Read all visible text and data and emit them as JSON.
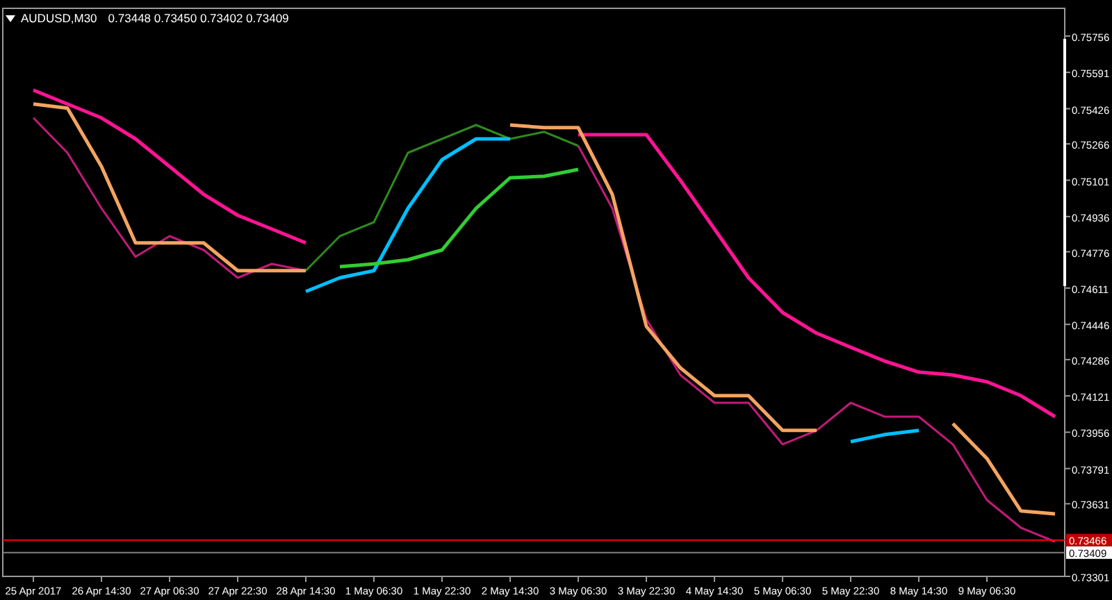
{
  "header": {
    "symbol": "AUDUSD,M30",
    "prices": [
      "0.73448",
      "0.73450",
      "0.73402",
      "0.73409"
    ]
  },
  "chart_data": {
    "type": "line",
    "categories": [
      "25 Apr 2017",
      null,
      "26 Apr 14:30",
      null,
      "27 Apr 06:30",
      null,
      "27 Apr 22:30",
      null,
      "28 Apr 14:30",
      null,
      "1 May 06:30",
      null,
      "1 May 22:30",
      null,
      "2 May 14:30",
      null,
      "3 May 06:30",
      null,
      "3 May 22:30",
      null,
      "4 May 14:30",
      null,
      "5 May 06:30",
      null,
      "5 May 22:30",
      null,
      "8 May 14:30",
      null,
      "9 May 06:30",
      null,
      null
    ],
    "ylim": [
      0.73301,
      0.75882
    ],
    "yticks": [
      {
        "value": 0.73301,
        "label": "0.73301"
      },
      {
        "value": 0.73631,
        "label": "0.73631"
      },
      {
        "value": 0.73791,
        "label": "0.73791"
      },
      {
        "value": 0.73956,
        "label": "0.73956"
      },
      {
        "value": 0.74121,
        "label": "0.74121"
      },
      {
        "value": 0.74286,
        "label": "0.74286"
      },
      {
        "value": 0.74446,
        "label": "0.74446"
      },
      {
        "value": 0.74611,
        "label": "0.74611"
      },
      {
        "value": 0.74776,
        "label": "0.74776"
      },
      {
        "value": 0.74936,
        "label": "0.74936"
      },
      {
        "value": 0.75101,
        "label": "0.75101"
      },
      {
        "value": 0.75266,
        "label": "0.75266"
      },
      {
        "value": 0.75426,
        "label": "0.75426"
      },
      {
        "value": 0.75591,
        "label": "0.75591"
      },
      {
        "value": 0.75756,
        "label": "0.75756"
      }
    ],
    "series": [
      {
        "color": "#c21a7a",
        "values": [
          0.75384,
          0.75226,
          0.74973,
          0.74753,
          0.74847,
          0.74784,
          0.74658,
          0.74721,
          0.7469,
          null,
          null,
          null,
          null,
          null,
          null,
          null,
          0.75257,
          0.74973,
          0.74469,
          0.74216,
          0.7409,
          0.7409,
          0.73901,
          0.73964,
          0.7409,
          0.74027,
          0.74027,
          0.73901,
          0.73648,
          0.73522,
          0.73459
        ]
      },
      {
        "color": "#2e8b1e",
        "values": [
          null,
          null,
          null,
          null,
          null,
          null,
          null,
          null,
          0.7469,
          0.74847,
          0.7491,
          0.75226,
          0.75289,
          0.75352,
          0.75289,
          0.75321,
          0.75257,
          null,
          null,
          null,
          null,
          null,
          null,
          null,
          null,
          null,
          null,
          null,
          null,
          null,
          null
        ]
      },
      {
        "color": "#ff1493",
        "values": [
          0.7551,
          0.75447,
          0.75384,
          0.75289,
          0.75163,
          0.75037,
          0.74942,
          0.74879,
          0.74816,
          null,
          null,
          null,
          null,
          null,
          null,
          null,
          0.75308,
          0.75308,
          0.75308,
          0.751,
          0.74879,
          0.74658,
          0.745,
          0.74406,
          0.74342,
          0.74279,
          0.74229,
          0.74216,
          0.74185,
          0.74122,
          0.74027
        ]
      },
      {
        "color": "#f4a460",
        "values": [
          0.75447,
          0.75428,
          0.75163,
          0.74816,
          0.74816,
          0.74816,
          0.7469,
          0.7469,
          0.7469,
          null,
          null,
          null,
          null,
          null,
          0.75352,
          0.7534,
          0.7534,
          0.75037,
          0.74437,
          0.74248,
          0.74122,
          0.74122,
          0.73964,
          0.73964,
          null,
          null,
          null,
          0.73995,
          0.73837,
          0.73598,
          0.73585
        ]
      },
      {
        "color": "#00bfff",
        "values": [
          null,
          null,
          null,
          null,
          null,
          null,
          null,
          null,
          0.74595,
          0.74658,
          0.7469,
          0.74973,
          0.75194,
          0.75289,
          0.75289,
          null,
          null,
          null,
          null,
          null,
          null,
          null,
          null,
          null,
          0.73913,
          0.73945,
          0.73964,
          null,
          null,
          null,
          null
        ]
      },
      {
        "color": "#32cd32",
        "values": [
          null,
          null,
          null,
          null,
          null,
          null,
          null,
          null,
          null,
          0.74708,
          0.74721,
          0.7474,
          0.74784,
          0.74973,
          0.75112,
          0.75119,
          0.7515,
          null,
          null,
          null,
          null,
          null,
          null,
          null,
          null,
          null,
          null,
          null,
          null,
          null,
          null
        ]
      }
    ],
    "ref_lines": [
      {
        "axis": "y",
        "value": 0.73466,
        "label": "0.73466",
        "color": "#ff0000"
      },
      {
        "axis": "y",
        "value": 0.73409,
        "label": "0.73409",
        "color": "#808080"
      }
    ]
  }
}
